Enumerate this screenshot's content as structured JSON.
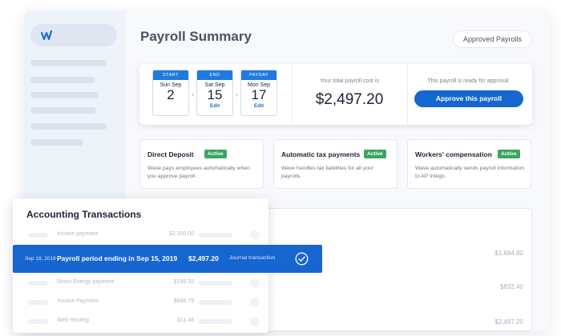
{
  "header": {
    "title": "Payroll Summary",
    "approved_label": "Approved Payrolls"
  },
  "summary": {
    "dates": [
      {
        "tag": "START",
        "day": "Sun Sep",
        "num": "2",
        "edit": ""
      },
      {
        "tag": "END",
        "day": "Sat Sep",
        "num": "15",
        "edit": "Edit"
      },
      {
        "tag": "PAYDAY",
        "day": "Mon Sep",
        "num": "17",
        "edit": "Edit"
      }
    ],
    "cost_label": "Your total payroll cost is",
    "cost_value": "$2,497.20",
    "ready_label": "This payroll is ready for approval",
    "approve_label": "Approve this payroll"
  },
  "features": [
    {
      "title": "Direct Deposit",
      "badge": "Active",
      "desc": "Wave pays employees automatically when you approve payroll."
    },
    {
      "title": "Automatic tax payments",
      "badge": "Active",
      "desc": "Wave handles tax liabilities for all your payrolls."
    },
    {
      "title": "Workers' compensation",
      "badge": "Active",
      "desc": "Wave automatically sends payroll information to AP Intego."
    }
  ],
  "background_amounts": [
    "$1,664.80",
    "$832.40",
    "$2,497.20"
  ],
  "accounting": {
    "title": "Accounting Transactions",
    "rows": [
      {
        "name": "Invoice payment",
        "amount": "$2,200.00"
      },
      {
        "name": "Direct Energy payment",
        "amount": "$158.32"
      },
      {
        "name": "Invoice Payment",
        "amount": "$898.79"
      },
      {
        "name": "Web Hosting",
        "amount": "$11.48"
      }
    ],
    "highlight": {
      "date": "Sep 18, 2019",
      "title": "Payroll period ending in Sep 15, 2019",
      "amount": "$2,497.20",
      "type": "Journal transaction"
    }
  },
  "colors": {
    "primary": "#1566cf",
    "active_badge": "#3aa55d",
    "sidebar": "#eef2f9"
  }
}
